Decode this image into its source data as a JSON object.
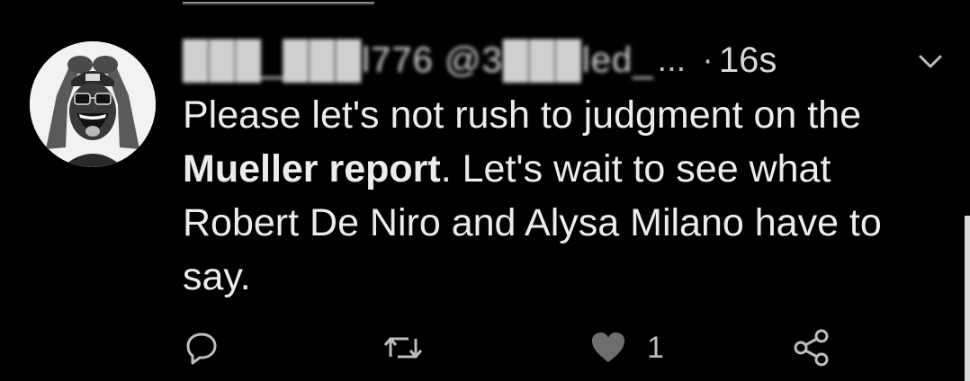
{
  "tweet": {
    "author_handle": "███_███l776 @3███led_",
    "ellipsis": "...",
    "separator": "·",
    "timestamp": "16s",
    "text_intro": "Please let's not rush to judgment on the ",
    "text_bold": "Mueller report",
    "text_rest": ". Let's wait to see what Robert De Niro and Alysa Milano have to say.",
    "like_count": "1"
  },
  "icons": {
    "reply": "speech-bubble-icon",
    "retweet": "retweet-arrows-icon",
    "like": "heart-icon",
    "share": "share-nodes-icon",
    "menu": "chevron-down-icon"
  },
  "colors": {
    "background": "#000000",
    "text": "#ececec",
    "secondary": "#bdbdbd"
  }
}
